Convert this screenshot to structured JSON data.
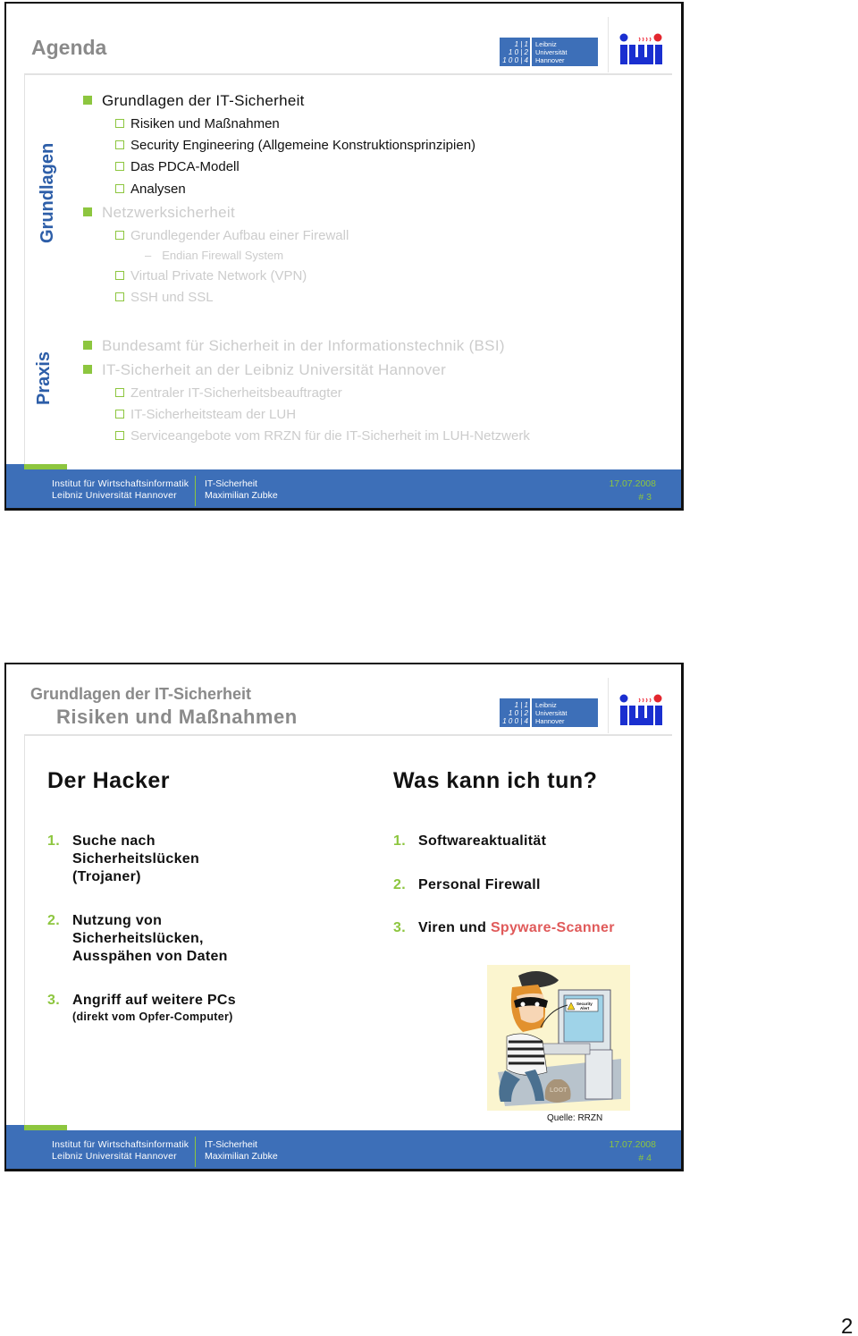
{
  "slides": [
    {
      "title": "Agenda",
      "logos": {
        "luh_digits": [
          "1 | 1",
          "1 0 | 2",
          "1 0 0 | 4"
        ],
        "luh_text": [
          "Leibniz",
          "Universität",
          "Hannover"
        ],
        "iwi": "iwi"
      },
      "sections": [
        {
          "label": "Grundlagen",
          "items": [
            {
              "level": 1,
              "text": "Grundlagen der IT-Sicherheit",
              "active": true
            },
            {
              "level": 2,
              "text": "Risiken und Maßnahmen",
              "active": true
            },
            {
              "level": 2,
              "text": "Security Engineering (Allgemeine Konstruktionsprinzipien)",
              "active": true
            },
            {
              "level": 2,
              "text": "Das PDCA-Modell",
              "active": true
            },
            {
              "level": 2,
              "text": "Analysen",
              "active": true
            },
            {
              "level": 1,
              "text": "Netzwerksicherheit",
              "active": false
            },
            {
              "level": 2,
              "text": "Grundlegender Aufbau einer Firewall",
              "active": false
            },
            {
              "level": 3,
              "text": "Endian Firewall System",
              "active": false
            },
            {
              "level": 2,
              "text": "Virtual Private Network (VPN)",
              "active": false
            },
            {
              "level": 2,
              "text": "SSH und SSL",
              "active": false
            }
          ]
        },
        {
          "label": "Praxis",
          "items": [
            {
              "level": 1,
              "text": "Bundesamt für Sicherheit in der Informationstechnik (BSI)",
              "active": false
            },
            {
              "level": 1,
              "text": "IT-Sicherheit an der Leibniz Universität Hannover",
              "active": false
            },
            {
              "level": 2,
              "text": "Zentraler IT-Sicherheitsbeauftragter",
              "active": false
            },
            {
              "level": 2,
              "text": "IT-Sicherheitsteam der LUH",
              "active": false
            },
            {
              "level": 2,
              "text": "Serviceangebote vom RRZN für die IT-Sicherheit im LUH-Netzwerk",
              "active": false
            }
          ]
        }
      ],
      "footer": {
        "institute": "Institut für Wirtschaftsinformatik",
        "university": "Leibniz Universität Hannover",
        "topic": "IT-Sicherheit",
        "author": "Maximilian Zubke",
        "date": "17.07.2008",
        "slide_no": "# 3"
      }
    },
    {
      "title_line1": "Grundlagen der IT-Sicherheit",
      "title_line2": "Risiken und Maßnahmen",
      "left": {
        "heading": "Der Hacker",
        "items": [
          {
            "num": "1.",
            "lines": [
              "Suche nach",
              "Sicherheitslücken",
              "(Trojaner)"
            ]
          },
          {
            "num": "2.",
            "lines": [
              "Nutzung von",
              "Sicherheitslücken,",
              "Ausspähen von Daten"
            ]
          },
          {
            "num": "3.",
            "lines": [
              "Angriff auf weitere PCs"
            ],
            "sub": "(direkt vom Opfer-Computer)"
          }
        ]
      },
      "right": {
        "heading": "Was kann ich tun?",
        "items": [
          {
            "num": "1.",
            "text": "Softwareaktualität"
          },
          {
            "num": "2.",
            "text": "Personal Firewall"
          },
          {
            "num": "3.",
            "text": "Viren und ",
            "highlight": "Spyware-Scanner"
          }
        ]
      },
      "illustration": {
        "alt": "Hacker cartoon with Security Alert monitor",
        "monitor_label": "Security Alert",
        "bag_label": "LOOT",
        "caption": "Quelle: RRZN"
      },
      "footer": {
        "institute": "Institut für Wirtschaftsinformatik",
        "university": "Leibniz Universität Hannover",
        "topic": "IT-Sicherheit",
        "author": "Maximilian Zubke",
        "date": "17.07.2008",
        "slide_no": "# 4"
      }
    }
  ],
  "page_number": "2",
  "colors": {
    "brand_blue": "#3d6fb8",
    "accent_green": "#8dc63f",
    "title_gray": "#8a8a8a",
    "inactive_gray": "#cccccc",
    "highlight_red": "#e05a5a"
  }
}
